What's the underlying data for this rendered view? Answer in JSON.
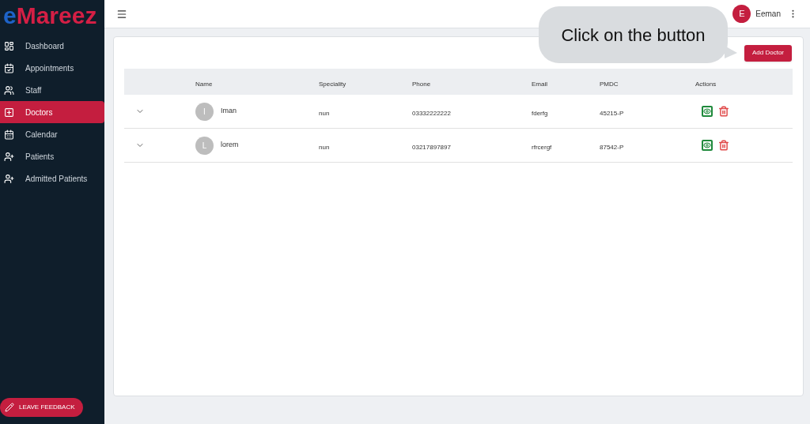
{
  "logo": {
    "prefix": "e",
    "name": "Mareez"
  },
  "sidebar": {
    "items": [
      {
        "label": "Dashboard",
        "selected": false
      },
      {
        "label": "Appointments",
        "selected": false
      },
      {
        "label": "Staff",
        "selected": false
      },
      {
        "label": "Doctors",
        "selected": true
      },
      {
        "label": "Calendar",
        "selected": false
      },
      {
        "label": "Patients",
        "selected": false
      },
      {
        "label": "Admitted Patients",
        "selected": false
      }
    ],
    "feedback_button": "LEAVE FEEDBACK"
  },
  "header": {
    "user": {
      "initial": "E",
      "name": "Eeman"
    }
  },
  "callout": "Click on the button",
  "add_button": "Add Doctor",
  "table": {
    "columns": [
      "Name",
      "Speciality",
      "Phone",
      "Email",
      "PMDC",
      "Actions"
    ],
    "rows": [
      {
        "initial": "I",
        "name": "Iman",
        "speciality": "nun",
        "phone": "03332222222",
        "email": "fderfg",
        "pmdc": "45215-P"
      },
      {
        "initial": "L",
        "name": "lorem",
        "speciality": "nun",
        "phone": "03217897897",
        "email": "rfrcergf",
        "pmdc": "87542-P"
      }
    ]
  }
}
